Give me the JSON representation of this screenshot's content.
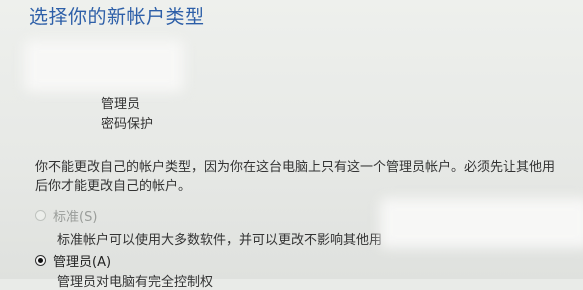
{
  "page": {
    "title": "选择你的新帐户类型"
  },
  "account": {
    "role": "管理员",
    "status": "密码保护"
  },
  "warning": {
    "line1": "你不能更改自己的帐户类型，因为你在这台电脑上只有这一个管理员帐户。必须先让其他用",
    "line2": "后你才能更改自己的帐户。"
  },
  "options": {
    "standard": {
      "label": "标准(S)",
      "description": "标准帐户可以使用大多数软件，并可以更改不影响其他用",
      "selected": false,
      "enabled": false
    },
    "administrator": {
      "label": "管理员(A)",
      "description": "管理员对电脑有完全控制权",
      "selected": true,
      "enabled": true
    }
  },
  "colors": {
    "title": "#2d5fa8",
    "background": "#e9ebe8",
    "disabled_text": "#9a9d9a"
  }
}
